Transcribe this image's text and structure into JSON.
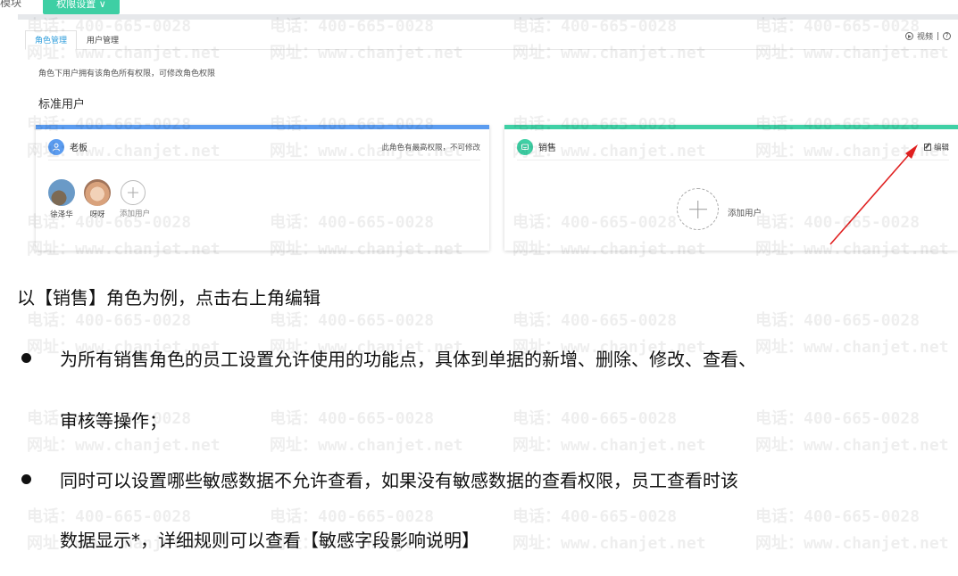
{
  "top": {
    "left_text": "模块",
    "green_button_label": "权限设置 ∨"
  },
  "tabs": [
    {
      "label": "角色管理",
      "active": true
    },
    {
      "label": "用户管理",
      "active": false
    }
  ],
  "help": {
    "video_label": "视频",
    "separator": "|",
    "help_icon": "?"
  },
  "description": "角色下用户拥有该角色所有权限，可修改角色权限",
  "section_title": "标准用户",
  "cards": {
    "boss": {
      "name": "老板",
      "note": "此角色有最高权限，不可修改",
      "accent": "#5b9cf0",
      "members": [
        {
          "name": "徐泽华"
        },
        {
          "name": "呀呀"
        }
      ],
      "add_label": "添加用户"
    },
    "sales": {
      "name": "销售",
      "edit_label": "编辑",
      "accent": "#3fd0a5",
      "add_label": "添加用户"
    }
  },
  "caption": "以【销售】角色为例，点击右上角编辑",
  "bullets": [
    {
      "lines": [
        "为所有销售角色的员工设置允许使用的功能点，具体到单据的新增、删除、修改、查看、",
        "审核等操作；"
      ]
    },
    {
      "lines": [
        "同时可以设置哪些敏感数据不允许查看，如果没有敏感数据的查看权限，员工查看时该",
        "数据显示*，详细规则可以查看【敏感字段影响说明】"
      ]
    }
  ],
  "watermark": {
    "phone": "电话：400-665-0028",
    "site": "网址：www.chanjet.net"
  }
}
